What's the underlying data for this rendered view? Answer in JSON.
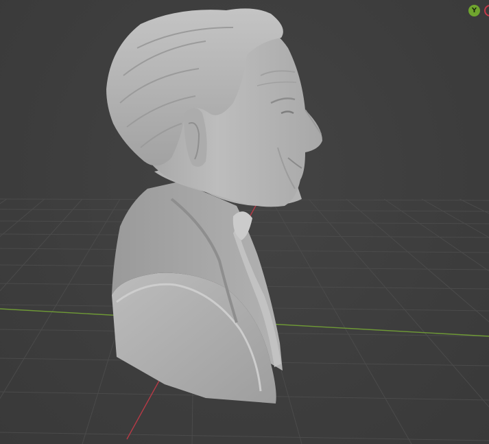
{
  "viewport": {
    "name": "3D Viewport",
    "background_color": "#3d3d3d",
    "grid_color": "#4a4a4a",
    "axis_x_color": "#c8394a",
    "axis_y_color": "#7aa83a"
  },
  "navigation_gizmo": {
    "y_axis_label": "Y",
    "y_axis_color": "#6fa52e",
    "x_axis_color": "#c8394a"
  },
  "model": {
    "icon": "sculpted-bust",
    "material_color": "#b4b4b4"
  }
}
